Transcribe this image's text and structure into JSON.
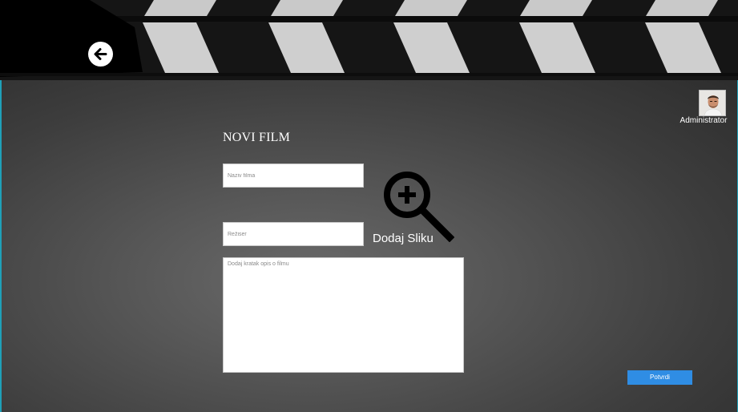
{
  "header": {
    "back_icon": "arrow-left-icon"
  },
  "user": {
    "name": "Administrator",
    "avatar_icon": "user-avatar"
  },
  "form": {
    "title": "NOVI FILM",
    "movie_name_placeholder": "Naziv filma",
    "director_placeholder": "Režiser",
    "description_placeholder": "Dodaj kratak opis o filmu",
    "add_image_label": "Dodaj Sliku",
    "add_image_icon": "zoom-in-icon",
    "submit_label": "Potvrdi"
  },
  "colors": {
    "accent": "#2f8de4",
    "edge": "#1fa0b8"
  }
}
